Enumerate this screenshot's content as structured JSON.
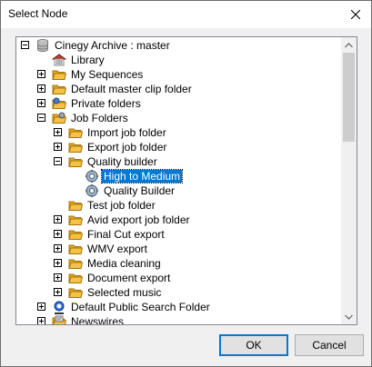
{
  "window": {
    "title": "Select Node"
  },
  "tree": {
    "items": [
      {
        "label": "Cinegy Archive : master",
        "level": 0,
        "expander": "minus",
        "icon": "database-icon"
      },
      {
        "label": "Library",
        "level": 1,
        "expander": "none",
        "icon": "library-icon"
      },
      {
        "label": "My Sequences",
        "level": 1,
        "expander": "plus",
        "icon": "folder-icon"
      },
      {
        "label": "Default master clip folder",
        "level": 1,
        "expander": "plus",
        "icon": "folder-icon"
      },
      {
        "label": "Private folders",
        "level": 1,
        "expander": "plus",
        "icon": "private-folder-icon"
      },
      {
        "label": "Job Folders",
        "level": 1,
        "expander": "minus",
        "icon": "job-folder-icon"
      },
      {
        "label": "Import job folder",
        "level": 2,
        "expander": "plus",
        "icon": "folder-icon"
      },
      {
        "label": "Export job folder",
        "level": 2,
        "expander": "plus",
        "icon": "folder-icon"
      },
      {
        "label": "Quality builder",
        "level": 2,
        "expander": "minus",
        "icon": "folder-icon"
      },
      {
        "label": "High to Medium",
        "level": 3,
        "expander": "none",
        "icon": "gear-icon",
        "selected": true
      },
      {
        "label": "Quality Builder",
        "level": 3,
        "expander": "none",
        "icon": "gear-icon"
      },
      {
        "label": "Test job folder",
        "level": 2,
        "expander": "none",
        "icon": "folder-icon"
      },
      {
        "label": "Avid export job folder",
        "level": 2,
        "expander": "plus",
        "icon": "folder-icon"
      },
      {
        "label": "Final Cut export",
        "level": 2,
        "expander": "plus",
        "icon": "folder-icon"
      },
      {
        "label": "WMV export",
        "level": 2,
        "expander": "plus",
        "icon": "folder-icon"
      },
      {
        "label": "Media cleaning",
        "level": 2,
        "expander": "plus",
        "icon": "folder-icon"
      },
      {
        "label": "Document export",
        "level": 2,
        "expander": "plus",
        "icon": "folder-icon"
      },
      {
        "label": "Selected music",
        "level": 2,
        "expander": "plus",
        "icon": "folder-icon"
      },
      {
        "label": "Default Public Search Folder",
        "level": 1,
        "expander": "plus",
        "icon": "search-folder-icon"
      },
      {
        "label": "Newswires",
        "level": 1,
        "expander": "plus",
        "icon": "newswire-icon"
      }
    ]
  },
  "buttons": {
    "ok": "OK",
    "cancel": "Cancel"
  },
  "colors": {
    "selection": "#0078d7",
    "folder": "#f5c242",
    "accent": "#0078d7"
  }
}
